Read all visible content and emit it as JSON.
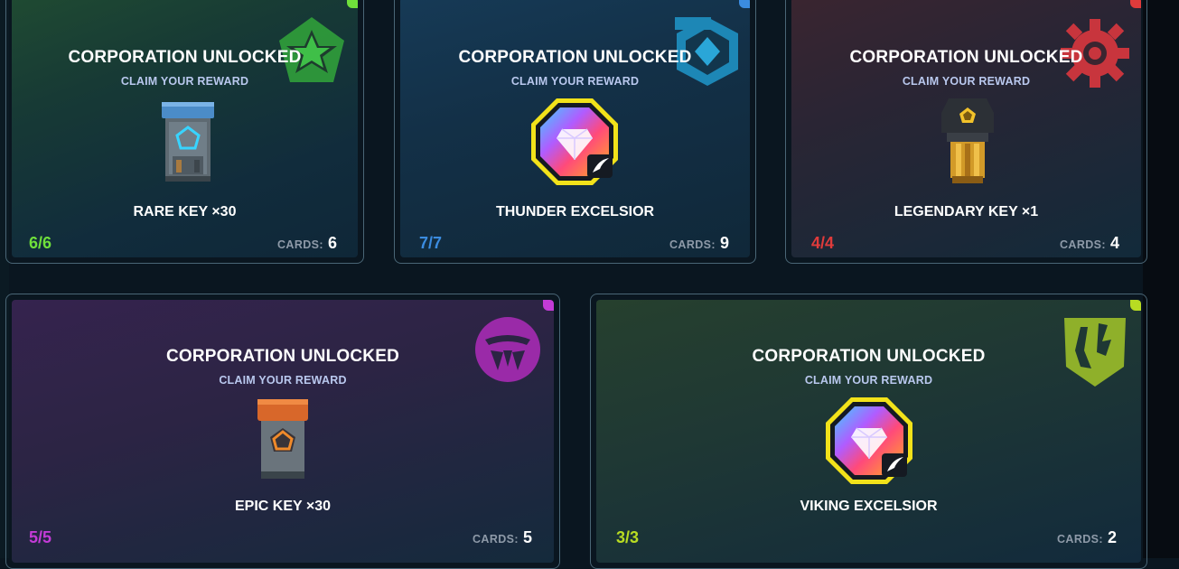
{
  "cards": [
    {
      "title": "CORPORATION UNLOCKED",
      "subtitle": "CLAIM YOUR REWARD",
      "reward": "RARE KEY ×30",
      "progress": "6/6",
      "cards_label": "CARDS:",
      "cards_count": "6",
      "accent": "#6fe03b",
      "emblem_icon": "star-shield-icon",
      "reward_icon": "rare-key-crate-icon"
    },
    {
      "title": "CORPORATION UNLOCKED",
      "subtitle": "CLAIM YOUR REWARD",
      "reward": "THUNDER EXCELSIOR",
      "progress": "7/7",
      "cards_label": "CARDS:",
      "cards_count": "9",
      "accent": "#3b8ce0",
      "emblem_icon": "diamond-hexagon-icon",
      "reward_icon": "excelsior-gem-icon"
    },
    {
      "title": "CORPORATION UNLOCKED",
      "subtitle": "CLAIM YOUR REWARD",
      "reward": "LEGENDARY KEY ×1",
      "progress": "4/4",
      "cards_label": "CARDS:",
      "cards_count": "4",
      "accent": "#e03b3b",
      "emblem_icon": "gear-icon",
      "reward_icon": "legendary-key-icon"
    },
    {
      "title": "CORPORATION UNLOCKED",
      "subtitle": "CLAIM YOUR REWARD",
      "reward": "EPIC KEY ×30",
      "progress": "5/5",
      "cards_label": "CARDS:",
      "cards_count": "5",
      "accent": "#c33bd6",
      "emblem_icon": "pincer-circle-icon",
      "reward_icon": "epic-key-crate-icon"
    },
    {
      "title": "CORPORATION UNLOCKED",
      "subtitle": "CLAIM YOUR REWARD",
      "reward": "VIKING EXCELSIOR",
      "progress": "3/3",
      "cards_label": "CARDS:",
      "cards_count": "2",
      "accent": "#b8dc22",
      "emblem_icon": "claw-shield-icon",
      "reward_icon": "excelsior-gem-icon"
    }
  ],
  "colors": {
    "page_bg": "#0a1620",
    "card_border": "#4a6676",
    "subtitle": "#b9c8ee",
    "cards_label": "#8e9aa8",
    "gem_frame": "#f2e21a"
  }
}
